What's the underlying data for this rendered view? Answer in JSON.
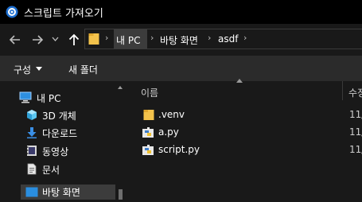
{
  "window": {
    "title": "스크립트 가져오기"
  },
  "address": {
    "breadcrumbs": [
      "내 PC",
      "바탕 화면",
      "asdf"
    ],
    "separator": "›"
  },
  "toolbar": {
    "organize_label": "구성",
    "new_folder_label": "새 폴더"
  },
  "nav_pane": {
    "items": [
      {
        "label": "내 PC",
        "icon": "computer-icon"
      },
      {
        "label": "3D 개체",
        "icon": "3d-objects-icon"
      },
      {
        "label": "다운로드",
        "icon": "download-icon"
      },
      {
        "label": "동영상",
        "icon": "video-icon"
      },
      {
        "label": "문서",
        "icon": "document-icon"
      },
      {
        "label": "바탕 화면",
        "icon": "desktop-icon",
        "selected": true
      }
    ]
  },
  "file_list": {
    "columns": {
      "name": "이름",
      "date": "수정"
    },
    "rows": [
      {
        "name": ".venv",
        "type": "folder",
        "date": "11/"
      },
      {
        "name": "a.py",
        "type": "python",
        "date": "11/"
      },
      {
        "name": "script.py",
        "type": "python",
        "date": "11/"
      }
    ]
  },
  "colors": {
    "background": "#191919",
    "title_bar": "#000000",
    "command_bar": "#2b2b2b",
    "selection": "#3c3c3c",
    "folder": "#f3c24b",
    "accent": "#0078d7"
  }
}
